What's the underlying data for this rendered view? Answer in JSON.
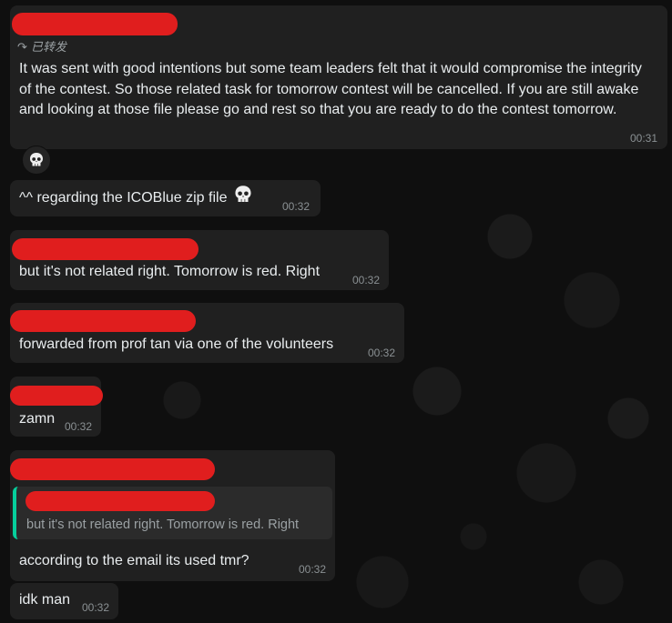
{
  "messages": [
    {
      "forwarded_label": "已转发",
      "text": "It was sent with good intentions but some team leaders felt that it would compromise the integrity of the contest. So those related task for tomorrow contest will be cancelled. If you are still awake and looking at those file please go and rest so that you are ready to do the contest tomorrow.",
      "time": "00:31",
      "reaction_icon": "skull-icon"
    },
    {
      "text": "^^ regarding the ICOBlue zip file",
      "time": "00:32",
      "emoji_icon": "skull-icon"
    },
    {
      "text": "but it's not related right. Tomorrow is red. Right",
      "time": "00:32"
    },
    {
      "text": "forwarded from prof tan via one of the volunteers",
      "time": "00:32"
    },
    {
      "text": "zamn",
      "time": "00:32"
    },
    {
      "quote_text": "but it's not related right. Tomorrow is red. Right",
      "text": "according to the email its used tmr?",
      "time": "00:32"
    },
    {
      "text": "idk man",
      "time": "00:32"
    }
  ],
  "colors": {
    "bubble": "#202020",
    "redaction": "#e01e1e",
    "quote_accent": "#06cf9c",
    "timestamp": "#8a9093"
  }
}
